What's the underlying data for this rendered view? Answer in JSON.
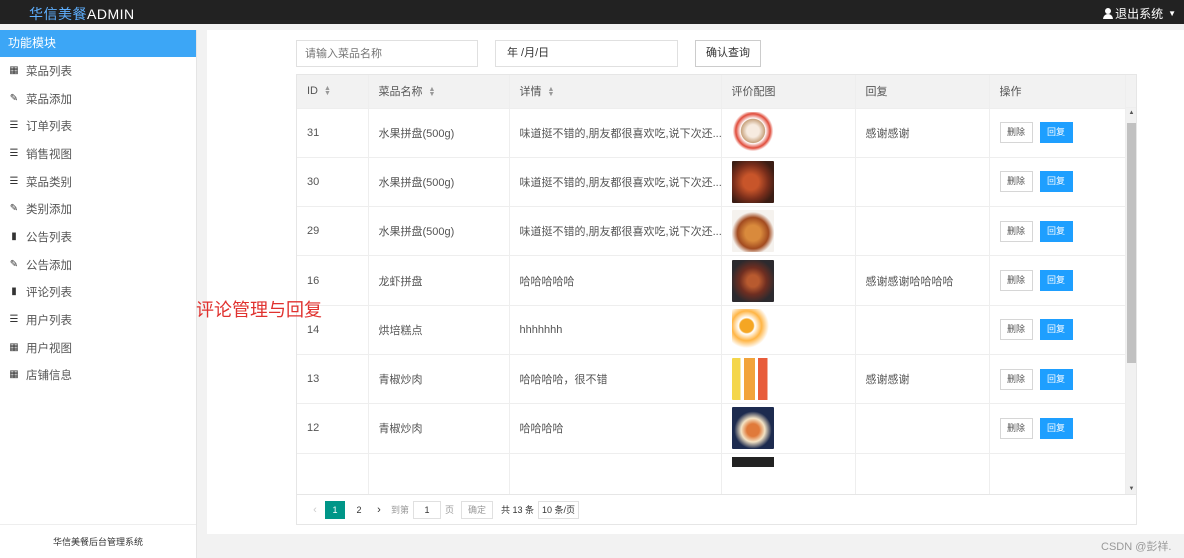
{
  "header": {
    "brand_cn": "华信美餐",
    "brand_en": "ADMIN",
    "logout_label": "退出系统"
  },
  "sidebar": {
    "title": "功能模块",
    "items": [
      {
        "label": "菜品列表",
        "icon": "grid-icon"
      },
      {
        "label": "菜品添加",
        "icon": "pencil-icon"
      },
      {
        "label": "订单列表",
        "icon": "list-icon"
      },
      {
        "label": "销售视图",
        "icon": "list-icon"
      },
      {
        "label": "菜品类别",
        "icon": "list-icon"
      },
      {
        "label": "类别添加",
        "icon": "pencil-icon"
      },
      {
        "label": "公告列表",
        "icon": "bar-chart-icon"
      },
      {
        "label": "公告添加",
        "icon": "pencil-icon"
      },
      {
        "label": "评论列表",
        "icon": "bar-chart-icon"
      },
      {
        "label": "用户列表",
        "icon": "list-icon"
      },
      {
        "label": "用户视图",
        "icon": "grid-icon"
      },
      {
        "label": "店铺信息",
        "icon": "grid-icon"
      }
    ],
    "footer": "华信美餐后台管理系统"
  },
  "search": {
    "placeholder": "请输入菜品名称",
    "date_placeholder": "年 /月/日",
    "submit_label": "确认查询"
  },
  "table": {
    "columns": [
      "ID",
      "菜品名称",
      "详情",
      "评价配图",
      "回复",
      "操作"
    ],
    "rows": [
      {
        "id": "31",
        "name": "水果拼盘(500g)",
        "detail": "味道挺不错的,朋友都很喜欢吃,说下次还...",
        "reply": "感谢感谢",
        "img": "cake-photo"
      },
      {
        "id": "30",
        "name": "水果拼盘(500g)",
        "detail": "味道挺不错的,朋友都很喜欢吃,说下次还...",
        "reply": "",
        "img": "roast-photo"
      },
      {
        "id": "29",
        "name": "水果拼盘(500g)",
        "detail": "味道挺不错的,朋友都很喜欢吃,说下次还...",
        "reply": "",
        "img": "chicken-photo"
      },
      {
        "id": "16",
        "name": "龙虾拼盘",
        "detail": "哈哈哈哈哈",
        "reply": "感谢感谢哈哈哈哈",
        "img": "crayfish-photo"
      },
      {
        "id": "14",
        "name": "烘培糕点",
        "detail": "hhhhhhh",
        "reply": "",
        "img": "orange-photo"
      },
      {
        "id": "13",
        "name": "青椒炒肉",
        "detail": "哈哈哈哈，很不错",
        "reply": "感谢感谢",
        "img": "juice-photo"
      },
      {
        "id": "12",
        "name": "青椒炒肉",
        "detail": "哈哈哈哈",
        "reply": "",
        "img": "platter-photo"
      }
    ],
    "delete_label": "删除",
    "reply_label": "回复"
  },
  "pager": {
    "pages": [
      "1",
      "2"
    ],
    "current": "1",
    "goto_label": "到第",
    "goto_value": "1",
    "page_unit": "页",
    "confirm_label": "确定",
    "total_label": "共 13 条",
    "size_label": "10 条/页"
  },
  "annotation": "评论管理与回复",
  "watermark": "CSDN @彭祥.",
  "colors": {
    "topbar": "#222222",
    "sidebar_active": "#3ca6f6",
    "reply_button": "#1e9fff",
    "page_active": "#009688",
    "annotation": "#e0322f"
  }
}
